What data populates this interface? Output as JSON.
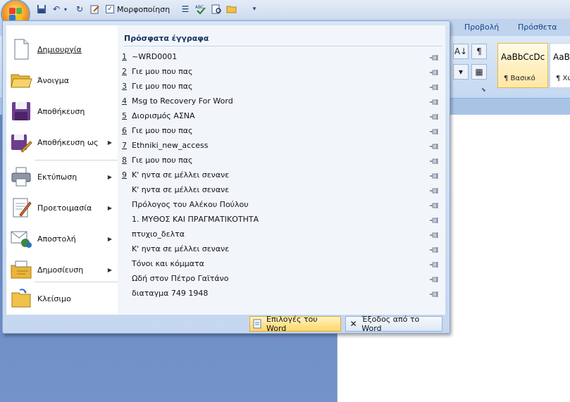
{
  "qat": {
    "format_label": "Μορφοποίηση"
  },
  "ribbon": {
    "tabs": [
      "Προβολή",
      "Πρόσθετα"
    ],
    "styles": [
      {
        "sample": "AaBbCcDc",
        "name": "¶ Βασικό"
      },
      {
        "sample": "AaBbCcDc",
        "name": "¶ Χωρ"
      }
    ]
  },
  "menu": {
    "commands": [
      {
        "label": "Δημιουργία"
      },
      {
        "label": "Άνοιγμα"
      },
      {
        "label": "Αποθήκευση"
      },
      {
        "label": "Αποθήκευση ως"
      },
      {
        "label": "Εκτύπωση"
      },
      {
        "label": "Προετοιμασία"
      },
      {
        "label": "Αποστολή"
      },
      {
        "label": "Δημοσίευση"
      },
      {
        "label": "Κλείσιμο"
      }
    ],
    "recent_title": "Πρόσφατα έγγραφα",
    "recent": [
      {
        "num": "1",
        "name": "~WRD0001"
      },
      {
        "num": "2",
        "name": "Γιε μου που πας"
      },
      {
        "num": "3",
        "name": "Γιε μου που πας"
      },
      {
        "num": "4",
        "name": "Msg to Recovery For Word"
      },
      {
        "num": "5",
        "name": "Διορισμός ΑΣΝΑ"
      },
      {
        "num": "6",
        "name": "Γιε μου που πας"
      },
      {
        "num": "7",
        "name": "Ethniki_new_access"
      },
      {
        "num": "8",
        "name": "Γιε μου που πας"
      },
      {
        "num": "9",
        "name": "Κ' ηντα σε μέλλει σενανε"
      },
      {
        "num": "",
        "name": "Κ' ηντα σε μέλλει σενανε"
      },
      {
        "num": "",
        "name": "Πρόλογος του Αλέκου Πούλου"
      },
      {
        "num": "",
        "name": "1. ΜΥΘΟΣ  ΚΑΙ  ΠΡΑΓΜΑΤΙΚΟΤΗΤΑ"
      },
      {
        "num": "",
        "name": "πτυχιο_δελτα"
      },
      {
        "num": "",
        "name": "Κ' ηντα σε μέλλει σενανε"
      },
      {
        "num": "",
        "name": "Τόνοι και κόμματα"
      },
      {
        "num": "",
        "name": "Ωδή στον Πέτρο Γαϊτάνο"
      },
      {
        "num": "",
        "name": "διαταγμα 749 1948"
      }
    ],
    "word_options_label": "Επιλογές του Word",
    "exit_label": "Έξοδος από το Word"
  }
}
